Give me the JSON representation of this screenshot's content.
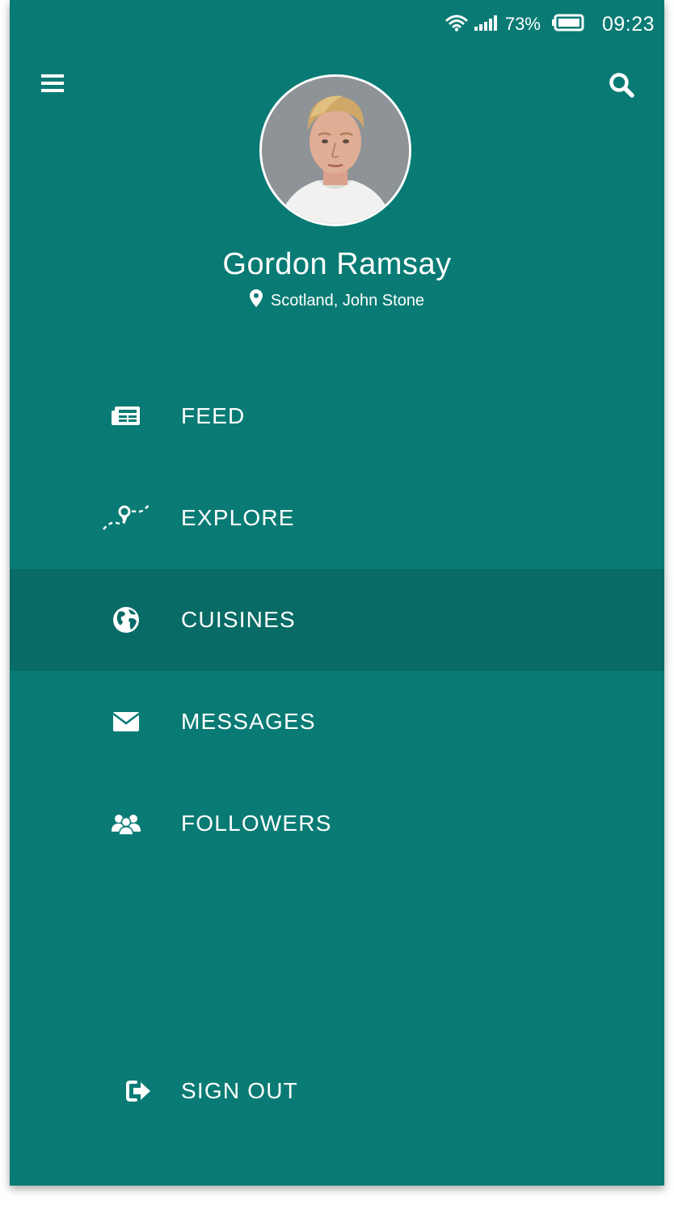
{
  "status_bar": {
    "battery_percent": "73%",
    "time": "09:23",
    "icons": [
      "wifi-icon",
      "signal-icon",
      "battery-icon"
    ]
  },
  "header": {
    "menu_icon": "hamburger-menu-icon",
    "search_icon": "search-icon"
  },
  "profile": {
    "name": "Gordon Ramsay",
    "location": "Scotland, John Stone",
    "location_icon": "map-pin-icon"
  },
  "nav": {
    "items": [
      {
        "label": "FEED",
        "icon": "newspaper-icon",
        "active": false
      },
      {
        "label": "EXPLORE",
        "icon": "route-icon",
        "active": false
      },
      {
        "label": "CUISINES",
        "icon": "globe-icon",
        "active": true
      },
      {
        "label": "MESSAGES",
        "icon": "envelope-icon",
        "active": false
      },
      {
        "label": "FOLLOWERS",
        "icon": "users-icon",
        "active": false
      }
    ],
    "sign_out": {
      "label": "SIGN OUT",
      "icon": "sign-out-icon"
    }
  },
  "colors": {
    "background": "#097b74",
    "active_item": "#086b66",
    "text": "#ffffff"
  }
}
